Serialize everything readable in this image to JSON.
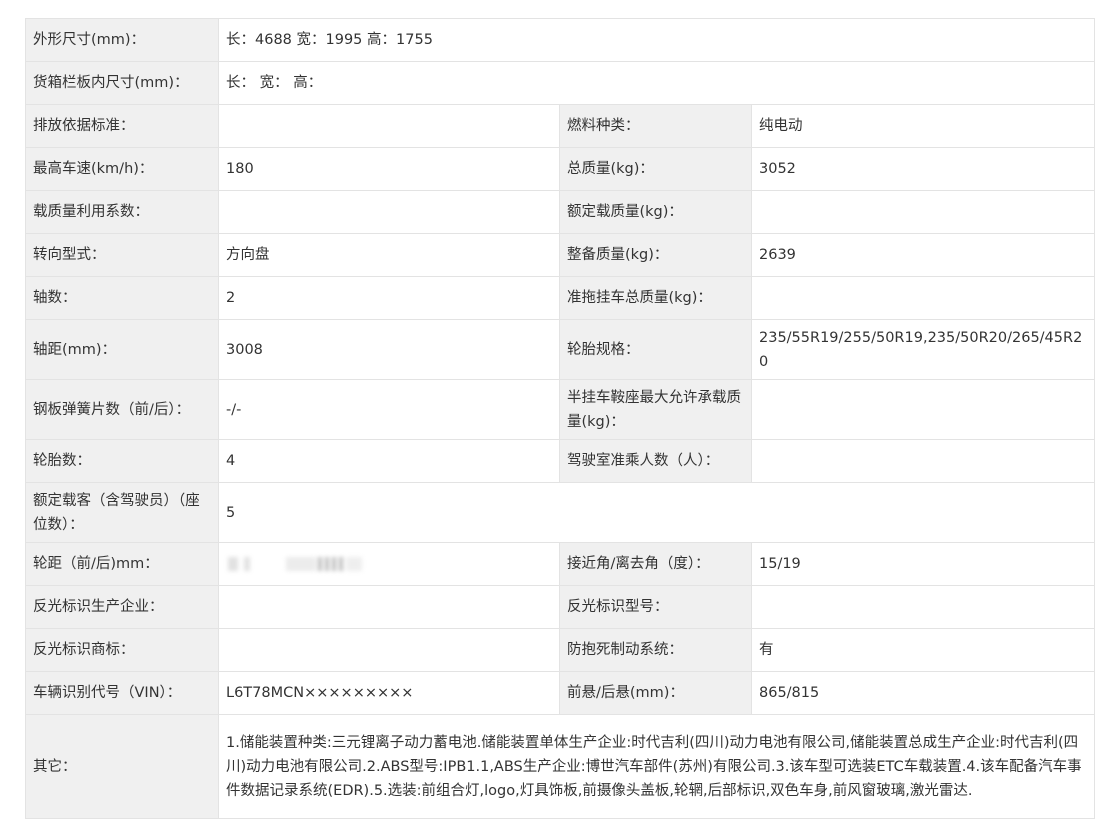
{
  "rows": {
    "r0": {
      "l1": "外形尺寸(mm)：",
      "v1": "长：4688 宽：1995 高：1755"
    },
    "r1": {
      "l1": "货箱栏板内尺寸(mm)：",
      "v1": "长：  宽：  高："
    },
    "r2": {
      "l1": "排放依据标准：",
      "v1": "",
      "l2": "燃料种类：",
      "v2": "纯电动"
    },
    "r3": {
      "l1": "最高车速(km/h)：",
      "v1": "180",
      "l2": "总质量(kg)：",
      "v2": "3052"
    },
    "r4": {
      "l1": "载质量利用系数：",
      "v1": "",
      "l2": "额定载质量(kg)：",
      "v2": ""
    },
    "r5": {
      "l1": "转向型式：",
      "v1": "方向盘",
      "l2": "整备质量(kg)：",
      "v2": "2639"
    },
    "r6": {
      "l1": "轴数：",
      "v1": "2",
      "l2": "准拖挂车总质量(kg)：",
      "v2": ""
    },
    "r7": {
      "l1": "轴距(mm)：",
      "v1": "3008",
      "l2": "轮胎规格：",
      "v2": "235/55R19/255/50R19,235/50R20/265/45R20"
    },
    "r8": {
      "l1": "钢板弹簧片数（前/后）：",
      "v1": "-/-",
      "l2": "半挂车鞍座最大允许承载质量(kg)：",
      "v2": ""
    },
    "r9": {
      "l1": "轮胎数：",
      "v1": "4",
      "l2": "驾驶室准乘人数（人）：",
      "v2": ""
    },
    "r10": {
      "l1": "额定载客（含驾驶员）（座位数）：",
      "v1": "5"
    },
    "r11": {
      "l1": "轮距（前/后)mm：",
      "l2": "接近角/离去角（度）：",
      "v2": "15/19"
    },
    "r12": {
      "l1": "反光标识生产企业：",
      "v1": "",
      "l2": "反光标识型号：",
      "v2": ""
    },
    "r13": {
      "l1": "反光标识商标：",
      "v1": "",
      "l2": "防抱死制动系统：",
      "v2": "有"
    },
    "r14": {
      "l1": "车辆识别代号（VIN）：",
      "v1": "L6T78MCN×××××××××",
      "l2": "前悬/后悬(mm)：",
      "v2": "865/815"
    },
    "r15": {
      "l1": "其它：",
      "v1": "1.储能装置种类:三元锂离子动力蓄电池.储能装置单体生产企业:时代吉利(四川)动力电池有限公司,储能装置总成生产企业:时代吉利(四川)动力电池有限公司.2.ABS型号:IPB1.1,ABS生产企业:博世汽车部件(苏州)有限公司.3.该车型可选装ETC车载装置.4.该车配备汽车事件数据记录系统(EDR).5.选装:前组合灯,logo,灯具饰板,前摄像头盖板,轮辋,后部标识,双色车身,前风窗玻璃,激光雷达."
    }
  }
}
